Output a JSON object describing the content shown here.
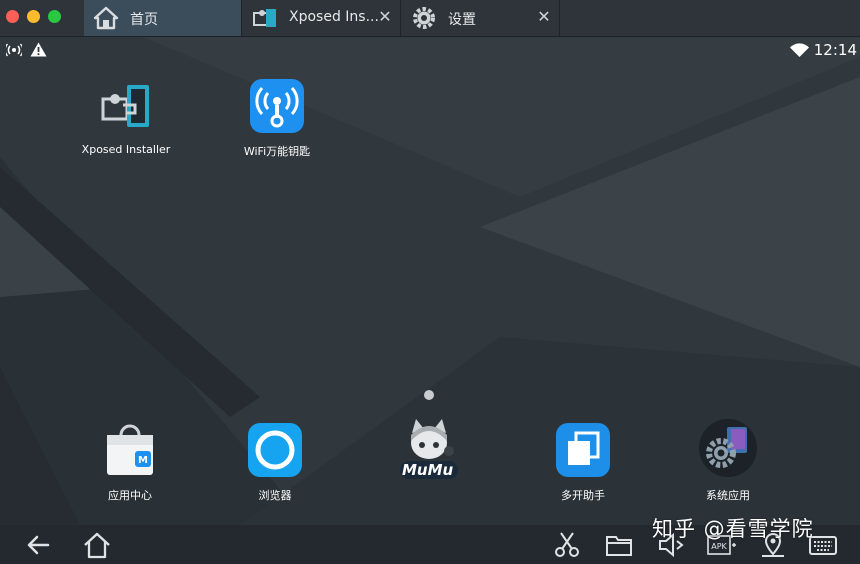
{
  "tabs": [
    {
      "label": "首页",
      "icon": "home-icon",
      "active": true,
      "closable": false
    },
    {
      "label": "Xposed Ins...",
      "icon": "xposed-puzzle-icon",
      "active": false,
      "closable": true
    },
    {
      "label": "设置",
      "icon": "gear-icon",
      "active": false,
      "closable": true
    }
  ],
  "tab_close_glyph": "✕",
  "status_bar": {
    "time": "12:14",
    "left_icons": [
      "hotspot-icon",
      "warning-icon"
    ],
    "right_icons": [
      "wifi-icon"
    ]
  },
  "home_apps_top": [
    {
      "label": "Xposed Installer",
      "icon": "xposed-installer-icon"
    },
    {
      "label": "WiFi万能钥匙",
      "icon": "wifi-key-icon"
    }
  ],
  "dock_apps": [
    {
      "label": "应用中心",
      "icon": "app-center-icon"
    },
    {
      "label": "浏览器",
      "icon": "browser-icon"
    },
    {
      "label": "",
      "icon": "mumu-mascot-icon"
    },
    {
      "label": "多开助手",
      "icon": "multi-open-icon"
    },
    {
      "label": "系统应用",
      "icon": "system-apps-icon"
    }
  ],
  "mumu_logo_text": "MuMu",
  "nav_buttons": [
    "back-icon",
    "home-nav-icon",
    "scissors-icon",
    "folder-icon",
    "volume-icon",
    "apk-install-icon",
    "location-icon",
    "keyboard-icon"
  ],
  "apk_label": "APK",
  "watermark": "知乎 @看雪学院",
  "colors": {
    "titlebar": "#2e3439",
    "active_tab": "#3b4c5a",
    "screen_bg": "#30373d",
    "navbar": "#23292e",
    "accent_blue": "#1e90f0"
  }
}
